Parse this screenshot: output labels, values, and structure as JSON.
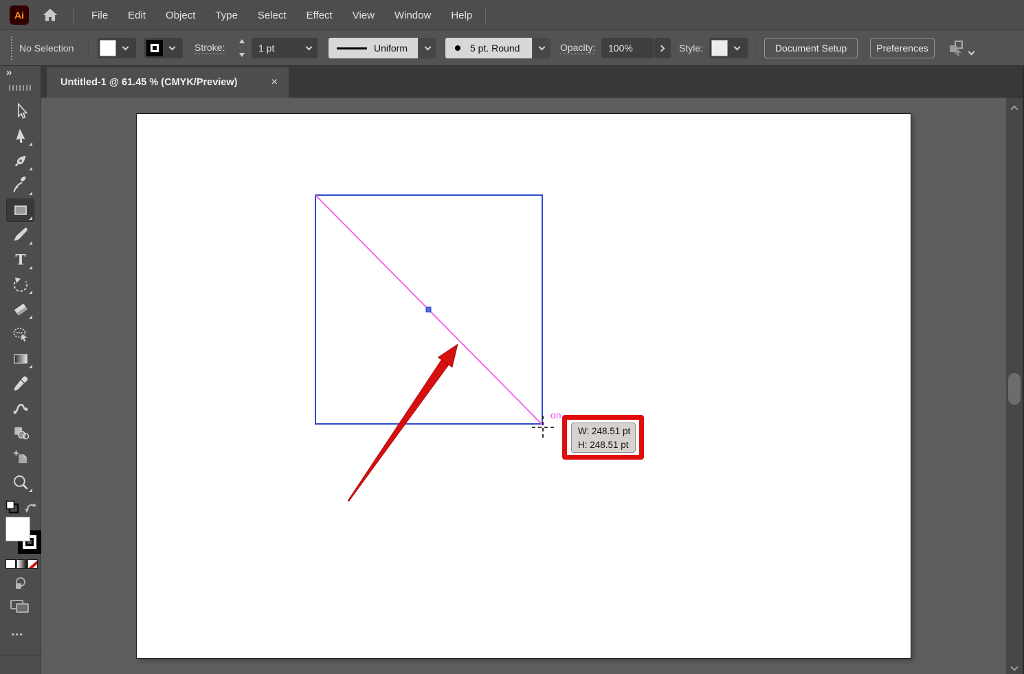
{
  "menu_bar": {
    "logo_text": "Ai",
    "menus": [
      "File",
      "Edit",
      "Object",
      "Type",
      "Select",
      "Effect",
      "View",
      "Window",
      "Help"
    ]
  },
  "control_bar": {
    "selection_status": "No Selection",
    "stroke_label": "Stroke:",
    "stroke_weight": "1 pt",
    "profile_value": "Uniform",
    "brush_value": "5 pt. Round",
    "opacity_label": "Opacity:",
    "opacity_value": "100%",
    "style_label": "Style:",
    "document_setup_label": "Document Setup",
    "preferences_label": "Preferences"
  },
  "document_tab": {
    "title": "Untitled-1 @ 61.45 % (CMYK/Preview)",
    "close_label": "×"
  },
  "toolbar": {
    "expand_label": "»",
    "more_label": "•••",
    "tools": [
      "selection-tool",
      "direct-selection-tool",
      "pen-tool",
      "curvature-tool",
      "rectangle-tool",
      "paintbrush-tool",
      "type-tool",
      "rotate-tool",
      "eraser-tool",
      "shaper-tool",
      "gradient-tool",
      "eyedropper-tool",
      "blend-tool",
      "shape-builder-tool",
      "artboard-tool",
      "zoom-tool"
    ],
    "selected_tool": "rectangle-tool"
  },
  "canvas": {
    "smart_guide_hint": "on",
    "measurement_tooltip": {
      "width": "W: 248.51 pt",
      "height": "H: 248.51 pt"
    }
  },
  "colors": {
    "smart_guide_magenta": "#fa50f3",
    "bounding_box_blue": "#2f4ad2",
    "annotation_red": "#d60f0f"
  }
}
